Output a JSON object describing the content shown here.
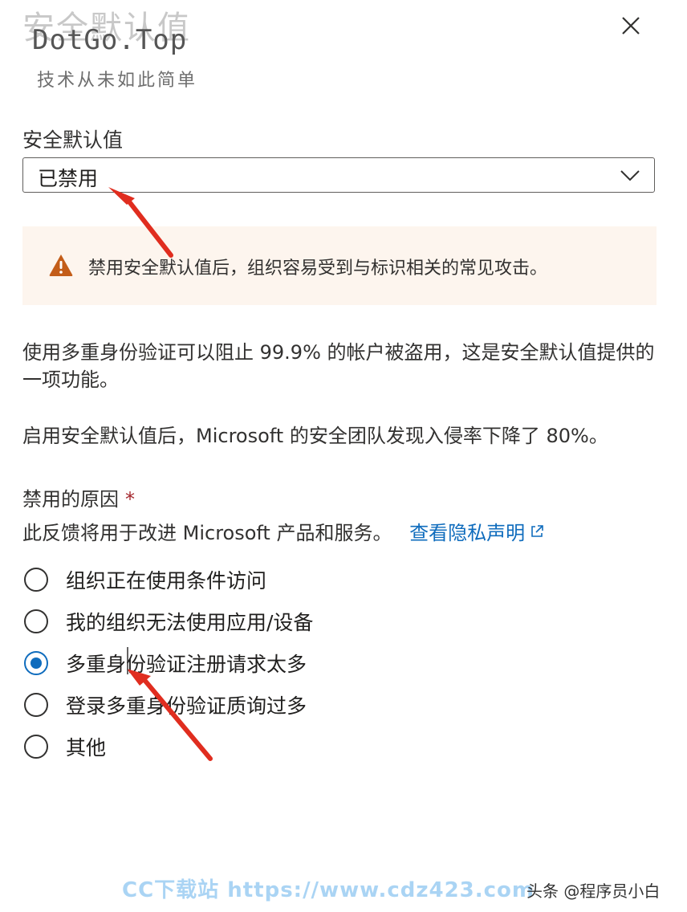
{
  "panel": {
    "title": "安全默认值",
    "close_label": "close"
  },
  "watermark": {
    "brand": "DotGo.Top",
    "tagline": "技术从未如此简单"
  },
  "security_defaults": {
    "label": "安全默认值",
    "selected_value": "已禁用"
  },
  "warning": {
    "icon": "warning-triangle-icon",
    "text": "禁用安全默认值后，组织容易受到与标识相关的常见攻击。"
  },
  "descriptions": [
    "使用多重身份验证可以阻止 99.9% 的帐户被盗用，这是安全默认值提供的一项功能。",
    "启用安全默认值后，Microsoft 的安全团队发现入侵率下降了 80%。"
  ],
  "reason": {
    "label": "禁用的原因",
    "required_mark": "*",
    "feedback_text": "此反馈将用于改进 Microsoft 产品和服务。",
    "privacy_link": "查看隐私声明",
    "options": [
      {
        "label": "组织正在使用条件访问",
        "selected": false
      },
      {
        "label": "我的组织无法使用应用/设备",
        "selected": false
      },
      {
        "label": "多重身份验证注册请求太多",
        "selected": true
      },
      {
        "label": "登录多重身份验证质询过多",
        "selected": false
      },
      {
        "label": "其他",
        "selected": false
      }
    ]
  },
  "footer": {
    "site_watermark": "CC下载站 https://www.cdz423.com",
    "credit": "头条 @程序员小白"
  },
  "colors": {
    "accent": "#0f6cbd",
    "warning_bg": "#fdf5ee",
    "warning_icon": "#c35d19",
    "annotation_arrow": "#e02d1f",
    "required": "#a4262c"
  }
}
